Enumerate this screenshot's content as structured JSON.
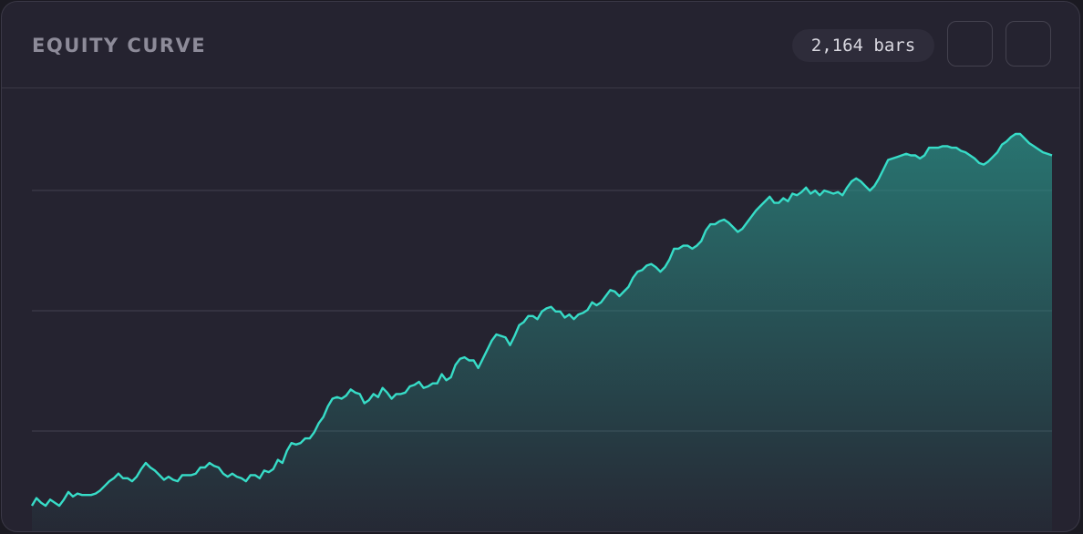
{
  "panel": {
    "title": "EQUITY CURVE",
    "bar_count_label": "2,164 bars",
    "buttons": [
      {
        "icon": "blank-button"
      },
      {
        "icon": "blank-button"
      }
    ]
  },
  "colors": {
    "background": "#252330",
    "line": "#37dcc7",
    "fill_top": "#2a8f86",
    "gridline": "#3a3846"
  },
  "chart_data": {
    "type": "area",
    "title": "EQUITY CURVE",
    "xlabel": "",
    "ylabel": "",
    "grid": true,
    "legend": "none",
    "ylim": [
      0,
      100
    ],
    "y": [
      7,
      12,
      9,
      7,
      11,
      9,
      7,
      11,
      16,
      13,
      15,
      14,
      14,
      14,
      15,
      17,
      20,
      23,
      25,
      28,
      25,
      25,
      23,
      26,
      31,
      35,
      32,
      30,
      27,
      24,
      26,
      24,
      23,
      27,
      27,
      27,
      28,
      32,
      32,
      35,
      33,
      32,
      28,
      26,
      28,
      26,
      25,
      23,
      27,
      27,
      25,
      30,
      29,
      31,
      37,
      35,
      43,
      48,
      47,
      48,
      51,
      51,
      55,
      61,
      65,
      72,
      77,
      78,
      77,
      79,
      83,
      81,
      80,
      74,
      76,
      80,
      78,
      84,
      81,
      77,
      80,
      80,
      81,
      85,
      86,
      88,
      84,
      85,
      87,
      87,
      93,
      89,
      91,
      99,
      103,
      104,
      102,
      102,
      97,
      103,
      109,
      115,
      119,
      118,
      117,
      112,
      118,
      125,
      127,
      131,
      131,
      129,
      134,
      136,
      137,
      134,
      134,
      130,
      132,
      129,
      132,
      133,
      135,
      140,
      138,
      140,
      144,
      148,
      147,
      144,
      147,
      150,
      156,
      160,
      161,
      164,
      165,
      163,
      160,
      163,
      168,
      175,
      175,
      177,
      177,
      175,
      177,
      180,
      187,
      191,
      191,
      193,
      194,
      192,
      189,
      186,
      188,
      192,
      196,
      200,
      203,
      206,
      209,
      205,
      205,
      208,
      206,
      211,
      210,
      212,
      215,
      211,
      213,
      210,
      213,
      212,
      211,
      212,
      210,
      215,
      219,
      221,
      219,
      216,
      213,
      216,
      221,
      227,
      233,
      234,
      235,
      236,
      237,
      236,
      236,
      234,
      236,
      241,
      241,
      241,
      242,
      242,
      241,
      241,
      239,
      238,
      236,
      234,
      231,
      230,
      232,
      235,
      238,
      243,
      245,
      248,
      250,
      250,
      247,
      244,
      242,
      240,
      238,
      237,
      236
    ]
  }
}
